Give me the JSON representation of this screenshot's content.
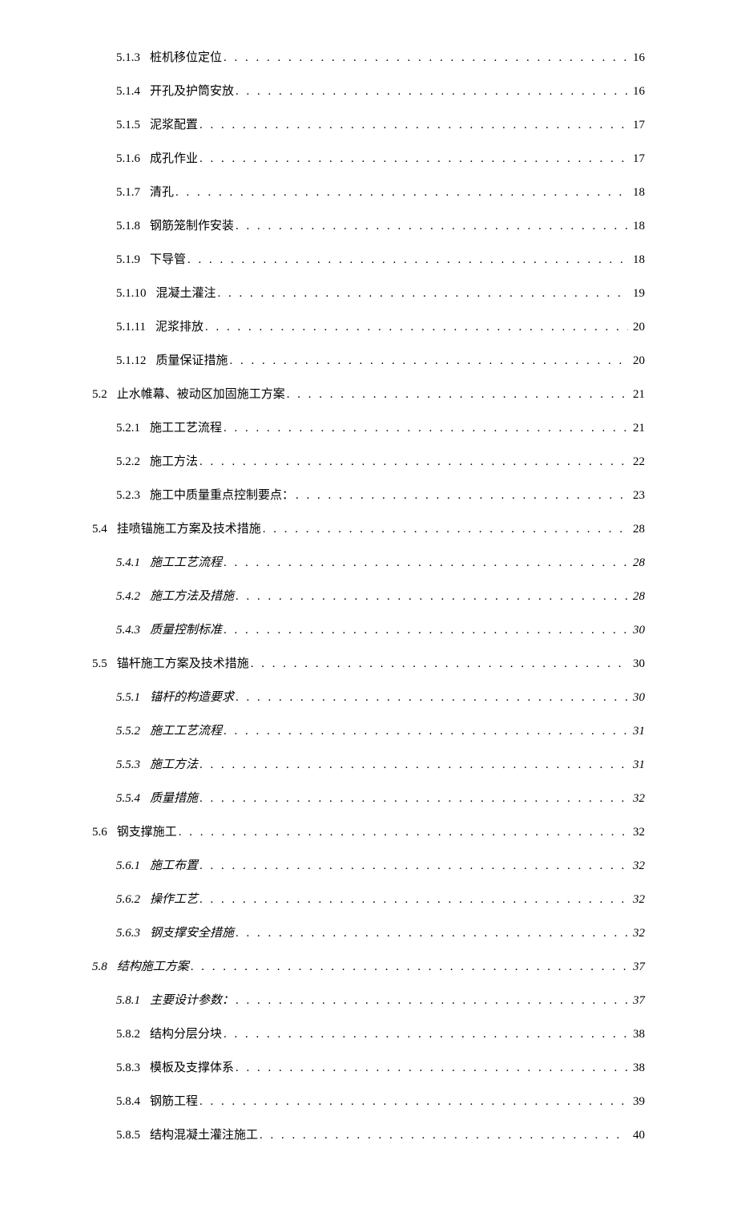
{
  "entries": [
    {
      "level": 3,
      "number": "5.1.3",
      "title": "桩机移位定位",
      "page": "16",
      "italic": false
    },
    {
      "level": 3,
      "number": "5.1.4",
      "title": "开孔及护筒安放",
      "page": "16",
      "italic": false
    },
    {
      "level": 3,
      "number": "5.1.5",
      "title": "泥浆配置",
      "page": "17",
      "italic": false
    },
    {
      "level": 3,
      "number": "5.1.6",
      "title": "成孔作业",
      "page": "17",
      "italic": false
    },
    {
      "level": 3,
      "number": "5.1.7",
      "title": "清孔",
      "page": "18",
      "italic": false
    },
    {
      "level": 3,
      "number": "5.1.8",
      "title": "钢筋笼制作安装",
      "page": "18",
      "italic": false
    },
    {
      "level": 3,
      "number": "5.1.9",
      "title": "下导管",
      "page": "18",
      "italic": false
    },
    {
      "level": 3,
      "number": "5.1.10",
      "title": "混凝土灌注",
      "page": "19",
      "italic": false
    },
    {
      "level": 3,
      "number": "5.1.11",
      "title": "泥浆排放",
      "page": "20",
      "italic": false
    },
    {
      "level": 3,
      "number": "5.1.12",
      "title": "质量保证措施",
      "page": "20",
      "italic": false
    },
    {
      "level": 2,
      "number": "5.2",
      "title": "止水帷幕、被动区加固施工方案",
      "page": "21",
      "italic": false
    },
    {
      "level": 3,
      "number": "5.2.1",
      "title": "施工工艺流程",
      "page": "21",
      "italic": false
    },
    {
      "level": 3,
      "number": "5.2.2",
      "title": "施工方法",
      "page": "22",
      "italic": false
    },
    {
      "level": 3,
      "number": "5.2.3",
      "title": "施工中质量重点控制要点：",
      "page": "23",
      "italic": false
    },
    {
      "level": 2,
      "number": "5.4",
      "title": "挂喷锚施工方案及技术措施",
      "page": "28",
      "italic": false
    },
    {
      "level": 3,
      "number": "5.4.1",
      "title": "施工工艺流程",
      "page": "28",
      "italic": true
    },
    {
      "level": 3,
      "number": "5.4.2",
      "title": "施工方法及措施",
      "page": "28",
      "italic": true
    },
    {
      "level": 3,
      "number": "5.4.3",
      "title": "质量控制标准",
      "page": "30",
      "italic": true
    },
    {
      "level": 2,
      "number": "5.5",
      "title": "锚杆施工方案及技术措施",
      "page": "30",
      "italic": false
    },
    {
      "level": 3,
      "number": "5.5.1",
      "title": "锚杆的构造要求",
      "page": "30",
      "italic": true
    },
    {
      "level": 3,
      "number": "5.5.2",
      "title": "施工工艺流程",
      "page": "31",
      "italic": true
    },
    {
      "level": 3,
      "number": "5.5.3",
      "title": "施工方法",
      "page": "31",
      "italic": true
    },
    {
      "level": 3,
      "number": "5.5.4",
      "title": "质量措施",
      "page": "32",
      "italic": true
    },
    {
      "level": 2,
      "number": "5.6",
      "title": "钢支撑施工",
      "page": "32",
      "italic": false
    },
    {
      "level": 3,
      "number": "5.6.1",
      "title": "施工布置",
      "page": "32",
      "italic": true
    },
    {
      "level": 3,
      "number": "5.6.2",
      "title": "操作工艺",
      "page": "32",
      "italic": true
    },
    {
      "level": 3,
      "number": "5.6.3",
      "title": "钢支撑安全措施",
      "page": "32",
      "italic": true
    },
    {
      "level": 2,
      "number": "5.8",
      "title": "结构施工方案",
      "page": "37",
      "italic": true
    },
    {
      "level": 3,
      "number": "5.8.1",
      "title": "主要设计参数：",
      "page": "37",
      "italic": true
    },
    {
      "level": 3,
      "number": "5.8.2",
      "title": "结构分层分块",
      "page": "38",
      "italic": false
    },
    {
      "level": 3,
      "number": "5.8.3",
      "title": "模板及支撑体系",
      "page": "38",
      "italic": false
    },
    {
      "level": 3,
      "number": "5.8.4",
      "title": "钢筋工程",
      "page": "39",
      "italic": false
    },
    {
      "level": 3,
      "number": "5.8.5",
      "title": "结构混凝土灌注施工",
      "page": "40",
      "italic": false
    }
  ]
}
